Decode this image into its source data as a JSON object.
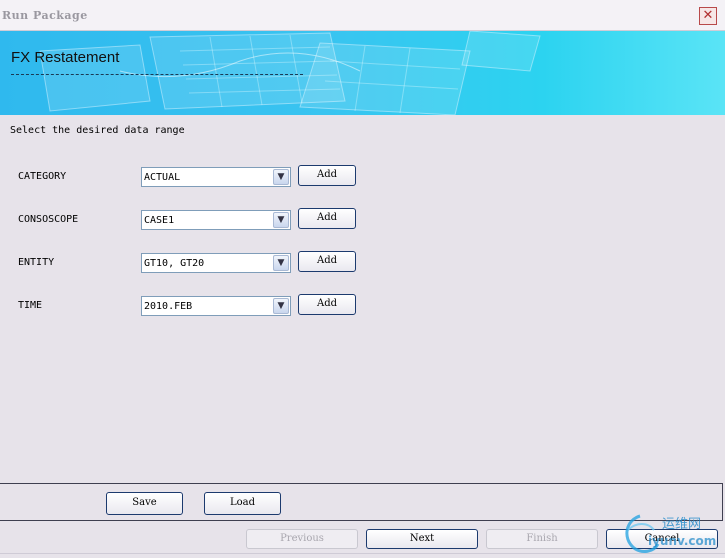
{
  "window": {
    "title": "Run Package",
    "close_glyph": "✕"
  },
  "banner": {
    "title": "FX Restatement"
  },
  "instruction": "Select the desired data range",
  "rows": [
    {
      "label": "CATEGORY",
      "value": "ACTUAL",
      "button": "Add"
    },
    {
      "label": "CONSOSCOPE",
      "value": "CASE1",
      "button": "Add"
    },
    {
      "label": "ENTITY",
      "value": "GT10, GT20",
      "button": "Add"
    },
    {
      "label": "TIME",
      "value": "2010.FEB",
      "button": "Add"
    }
  ],
  "actions": {
    "save": "Save",
    "load": "Load"
  },
  "wizard": {
    "previous": "Previous",
    "next": "Next",
    "finish": "Finish",
    "cancel": "Cancel"
  },
  "watermark": {
    "cn": "运维网",
    "url": "iyunv.com"
  },
  "icons": {
    "dropdown": "chevron-down-icon",
    "close": "close-icon"
  },
  "colors": {
    "banner": "#2fb9ee",
    "button_border": "#1c3a6e",
    "background": "#e7e3ea"
  }
}
